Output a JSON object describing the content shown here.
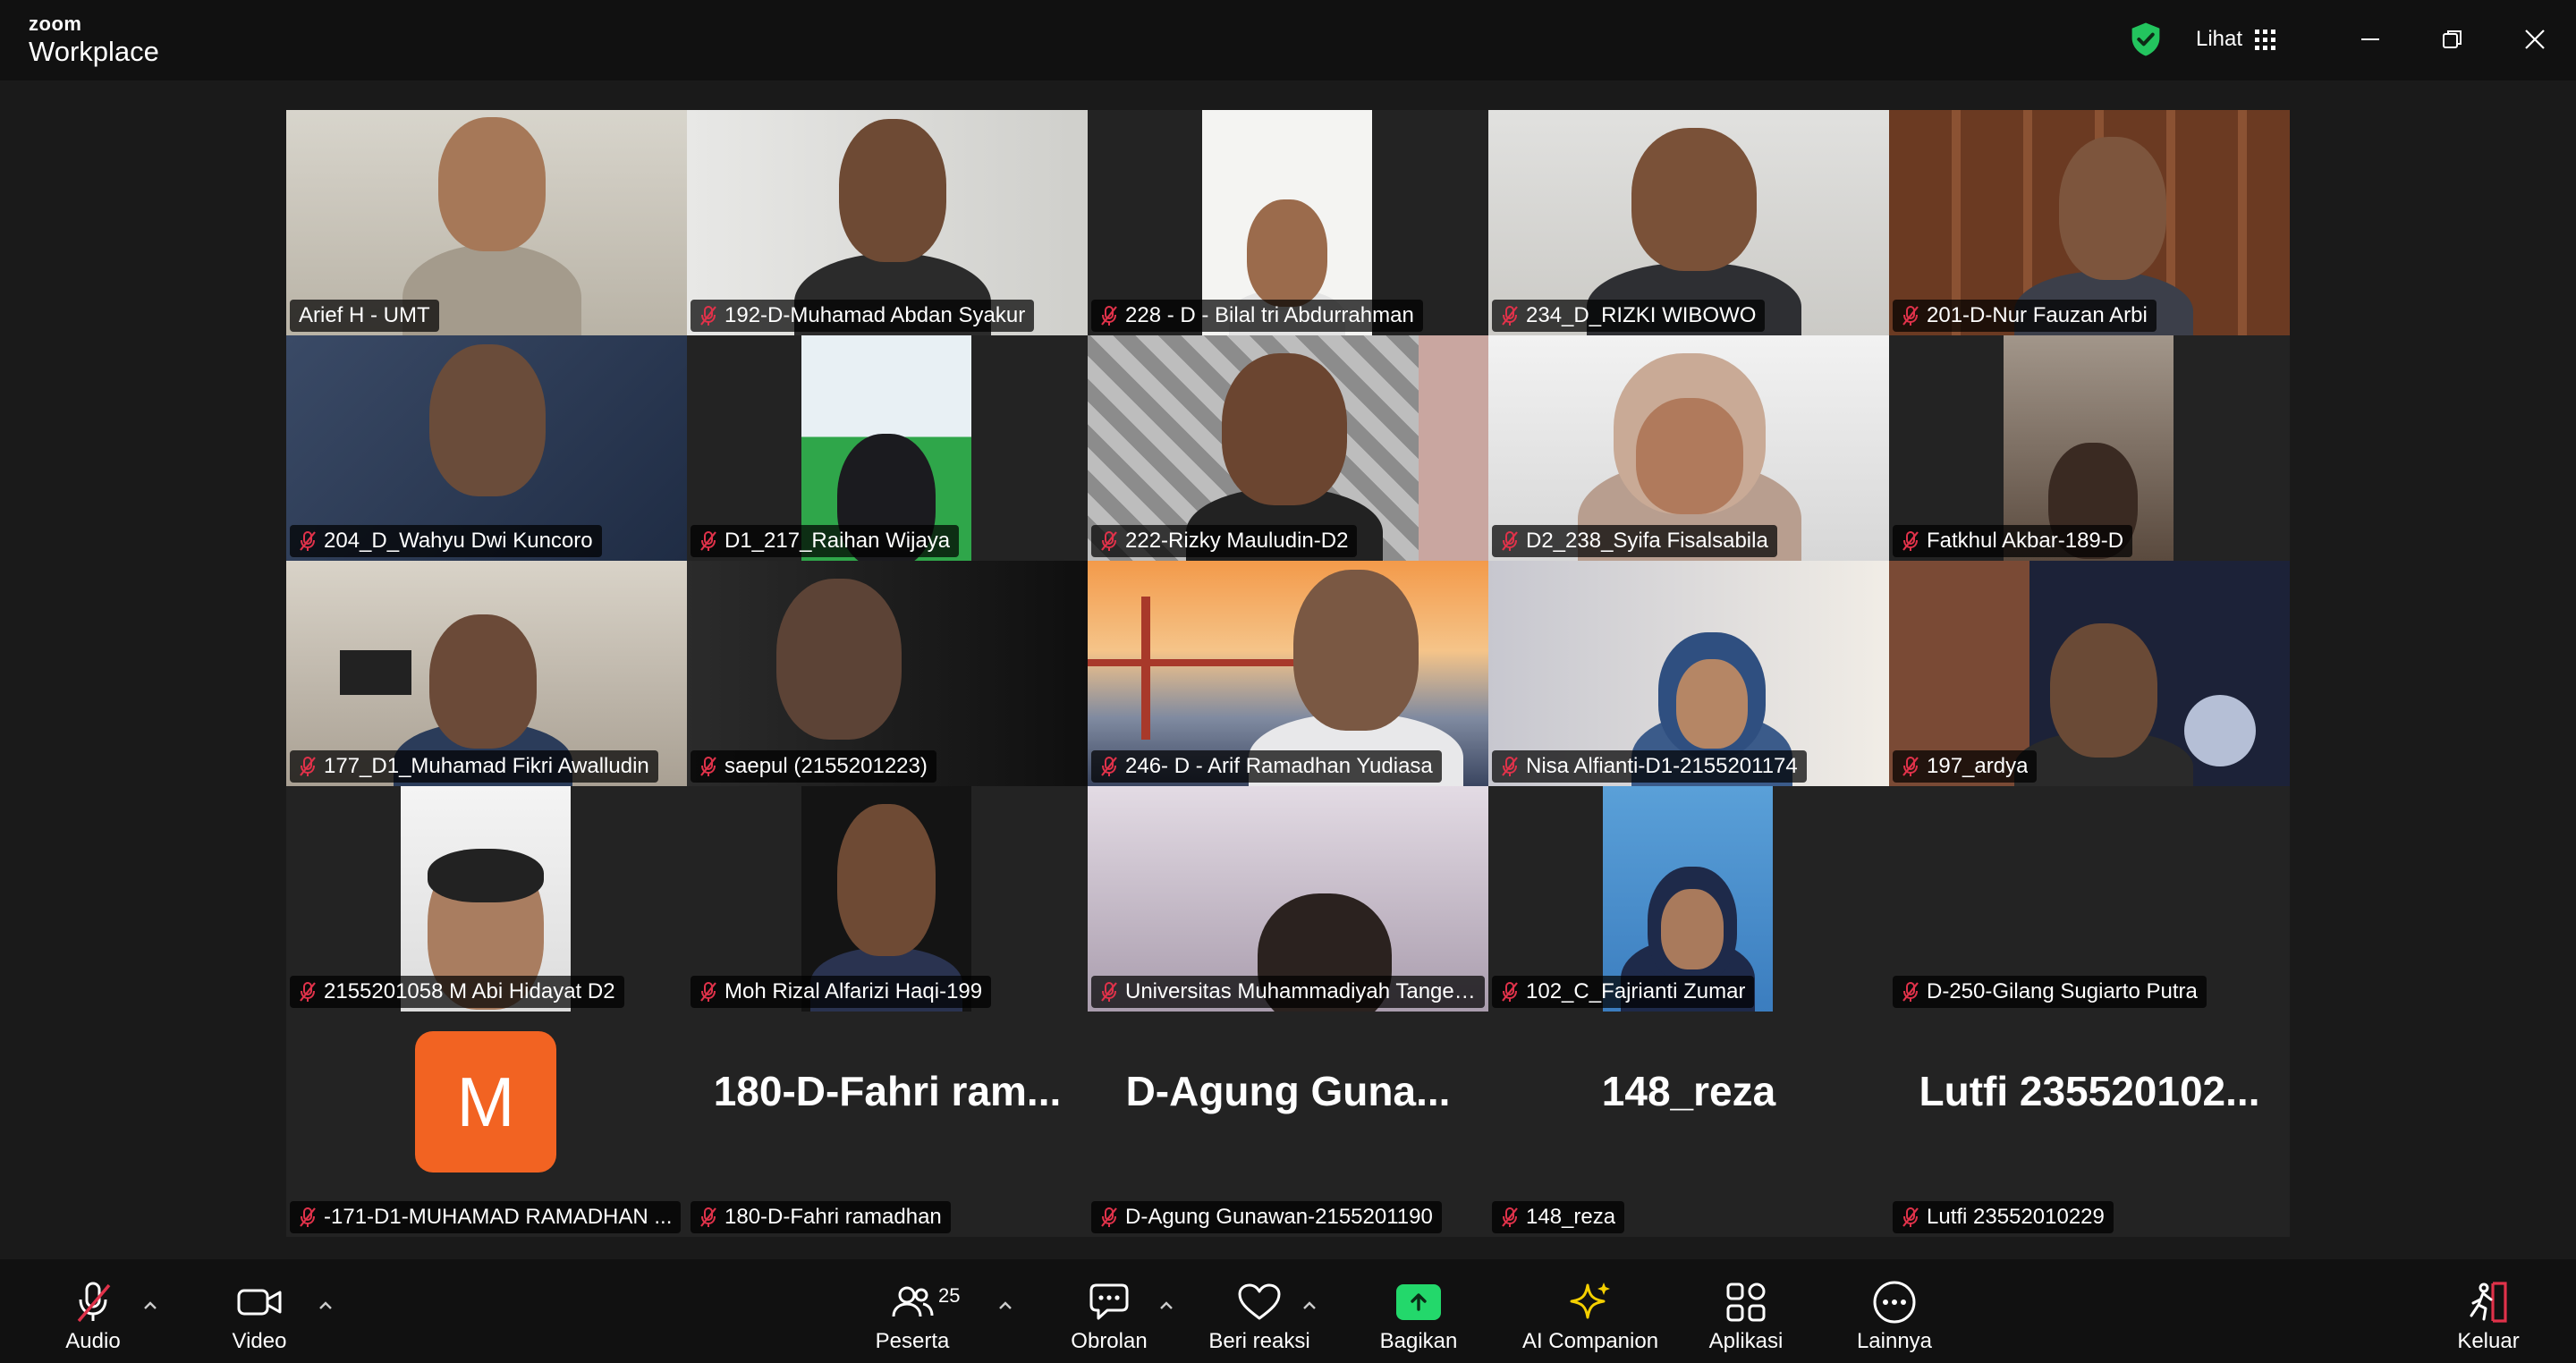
{
  "app": {
    "logo_top": "zoom",
    "logo_bottom": "Workplace",
    "view_label": "Lihat"
  },
  "participants": [
    {
      "name": "Arief H - UMT",
      "muted": false,
      "active": true
    },
    {
      "name": "192-D-Muhamad Abdan Syakur",
      "muted": true
    },
    {
      "name": "228 - D - Bilal tri Abdurrahman",
      "muted": true
    },
    {
      "name": "234_D_RIZKI WIBOWO",
      "muted": true
    },
    {
      "name": "201-D-Nur Fauzan Arbi",
      "muted": true
    },
    {
      "name": "204_D_Wahyu Dwi Kuncoro",
      "muted": true
    },
    {
      "name": "D1_217_Raihan Wijaya",
      "muted": true
    },
    {
      "name": "222-Rizky Mauludin-D2",
      "muted": true
    },
    {
      "name": "D2_238_Syifa Fisalsabila",
      "muted": true
    },
    {
      "name": "Fatkhul Akbar-189-D",
      "muted": true
    },
    {
      "name": "177_D1_Muhamad Fikri Awalludin",
      "muted": true
    },
    {
      "name": "saepul (2155201223)",
      "muted": true
    },
    {
      "name": "246- D - Arif Ramadhan Yudiasa",
      "muted": true
    },
    {
      "name": "Nisa Alfianti-D1-2155201174",
      "muted": true
    },
    {
      "name": "197_ardya",
      "muted": true
    },
    {
      "name": "2155201058 M Abi Hidayat D2",
      "muted": true
    },
    {
      "name": "Moh Rizal Alfarizi Haqi-199",
      "muted": true
    },
    {
      "name": "Universitas Muhammadiyah Tanger...",
      "muted": true
    },
    {
      "name": "102_C_Fajrianti Zumar",
      "muted": true
    },
    {
      "name": "D-250-Gilang Sugiarto Putra",
      "muted": true
    },
    {
      "name": "-171-D1-MUHAMAD RAMADHAN ...",
      "muted": true,
      "avatar_letter": "M"
    },
    {
      "name": "180-D-Fahri ramadhan",
      "muted": true,
      "display_text": "180-D-Fahri  ram..."
    },
    {
      "name": "D-Agung Gunawan-2155201190",
      "muted": true,
      "display_text": "D-Agung  Guna..."
    },
    {
      "name": "148_reza",
      "muted": true,
      "display_text": "148_reza"
    },
    {
      "name": "Lutfi 23552010229",
      "muted": true,
      "display_text": "Lutfi  235520102..."
    }
  ],
  "toolbar": {
    "audio": "Audio",
    "video": "Video",
    "participants": "Peserta",
    "participants_count": "25",
    "chat": "Obrolan",
    "react": "Beri reaksi",
    "share": "Bagikan",
    "ai": "AI Companion",
    "apps": "Aplikasi",
    "more": "Lainnya",
    "leave": "Keluar"
  },
  "colors": {
    "active_speaker": "#2bd46a",
    "share_green": "#23d86b",
    "mute_red": "#e0324a",
    "leave_red": "#e0324a",
    "ai_yellow": "#f5d000",
    "avatar_orange": "#f26322"
  }
}
